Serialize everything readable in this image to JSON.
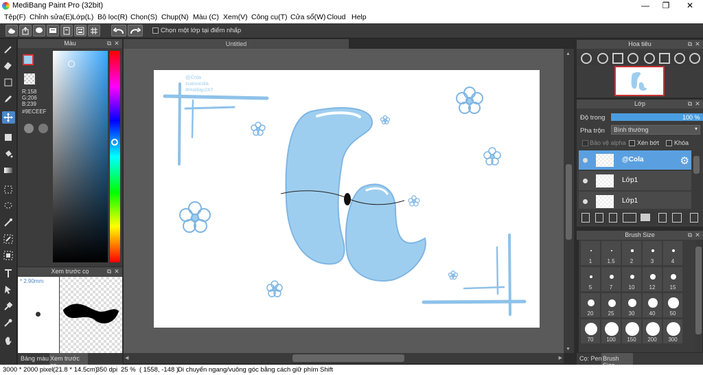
{
  "window": {
    "title": "MediBang Paint Pro (32bit)",
    "min": "—",
    "max": "❐",
    "close": "✕"
  },
  "menu": [
    "Tệp(F)",
    "Chỉnh sửa(E)",
    "Lớp(L)",
    "Bộ lọc(R)",
    "Chọn(S)",
    "Chụp(N)",
    "Màu (C)",
    "Xem(V)",
    "Công cụ(T)",
    "Cửa sổ(W)",
    "Cloud",
    "Help"
  ],
  "toolbar": {
    "snap_label": "Chọn một lớp tại điểm nhấp"
  },
  "color_panel": {
    "title": "Màu",
    "r": "R:158",
    "g": "G:206",
    "b": "B:239",
    "hex": "#9ECEEF",
    "fg_color": "#9ECEEF"
  },
  "brush_preview": {
    "title": "Xem trước cọ",
    "size": "* 2.90mm"
  },
  "bottom_tabs": {
    "palette": "Bảng màu",
    "preview": "Xem trước cọ"
  },
  "canvas": {
    "tab_title": "Untitled",
    "watermark": [
      "@Cola",
      "suasocola",
      "#Hoidap247"
    ]
  },
  "navigator": {
    "title": "Hoa tiêu"
  },
  "layer_panel": {
    "title": "Lớp",
    "opacity_label": "Độ trong",
    "opacity_value": "100 %",
    "opacity": 1.0,
    "blend_label": "Pha trộn",
    "blend_value": "Bình thường",
    "protect_alpha": "Bảo vệ alpha",
    "clipping": "Xén bớt",
    "lock": "Khóa",
    "layers": [
      {
        "name": "@Cola",
        "active": true
      },
      {
        "name": "Lớp1",
        "active": false
      },
      {
        "name": "Lớp1",
        "active": false
      }
    ]
  },
  "brush_size": {
    "title": "Brush Size",
    "sizes": [
      "1",
      "1.5",
      "2",
      "3",
      "4",
      "5",
      "7",
      "10",
      "12",
      "15",
      "20",
      "25",
      "30",
      "40",
      "50",
      "70",
      "100",
      "150",
      "200",
      "300"
    ]
  },
  "right_tabs": {
    "pen": "Cọ: Pen",
    "brush_size": "Brush Size"
  },
  "status": {
    "size": "3000 * 2000 pixel",
    "cm": "(21.8 * 14.5cm)",
    "dpi": "350 dpi",
    "zoom": "25 %",
    "coords": "( 1558, -148 )",
    "hint": "Di chuyển ngang/vuông góc bằng cách giữ phím Shift"
  },
  "colors": {
    "accent": "#4a86c8",
    "art": "#9ECEEF",
    "art_dark": "#7fb6e3"
  }
}
